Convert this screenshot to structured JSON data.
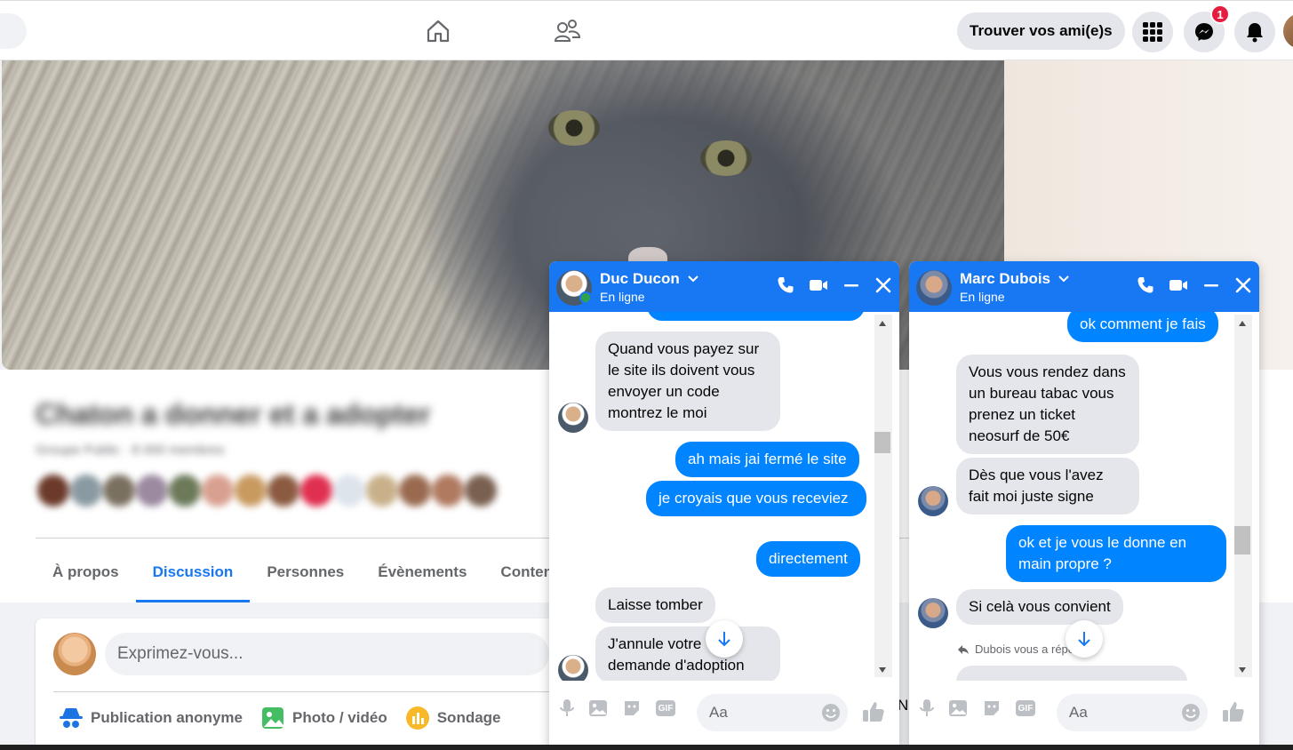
{
  "topbar": {
    "find_friends": "Trouver vos ami(e)s",
    "messenger_badge": "1",
    "icons": [
      "home-icon",
      "groups-icon",
      "menu-grid-icon",
      "messenger-icon",
      "bell-icon"
    ]
  },
  "group": {
    "title": "Chaton a donner et a adopter",
    "meta": "Groupe Public · 8 000 membres",
    "tabs": [
      "À propos",
      "Discussion",
      "Personnes",
      "Évènements",
      "Contenu"
    ],
    "active_tab": "Discussion"
  },
  "composer": {
    "placeholder": "Exprimez-vous...",
    "actions": [
      "Publication anonyme",
      "Photo / vidéo",
      "Sondage"
    ]
  },
  "chat1": {
    "name": "Duc Ducon",
    "status": "En ligne",
    "messages": [
      {
        "from": "them",
        "text": "Quand vous payez sur le site ils doivent vous envoyer un code montrez le moi"
      },
      {
        "from": "me",
        "text": "ah mais jai fermé le site"
      },
      {
        "from": "me",
        "text": "je croyais que vous receviez"
      },
      {
        "from": "me",
        "text": "directement"
      },
      {
        "from": "them",
        "text": "Laisse tomber"
      },
      {
        "from": "them",
        "text": "J'annule votre demande d'adoption"
      }
    ],
    "input_placeholder": "Aa"
  },
  "chat2": {
    "name": "Marc Dubois",
    "status": "En ligne",
    "messages": [
      {
        "from": "me",
        "text": "ok comment je fais"
      },
      {
        "from": "them",
        "text": "Vous vous rendez dans un bureau tabac vous prenez un ticket neosurf de 50€"
      },
      {
        "from": "them",
        "text": "Dès que vous l'avez fait moi juste signe"
      },
      {
        "from": "me",
        "text": "ok et je vous le donne en main propre ?"
      },
      {
        "from": "them",
        "text": "Si celà vous convient"
      }
    ],
    "reply_note": "Dubois vous a répondu",
    "input_placeholder": "Aa"
  },
  "colors": {
    "accent": "#1877f2",
    "bubble_out": "#0084ff",
    "bubble_in": "#e4e6eb",
    "badge": "#e41e3f"
  }
}
